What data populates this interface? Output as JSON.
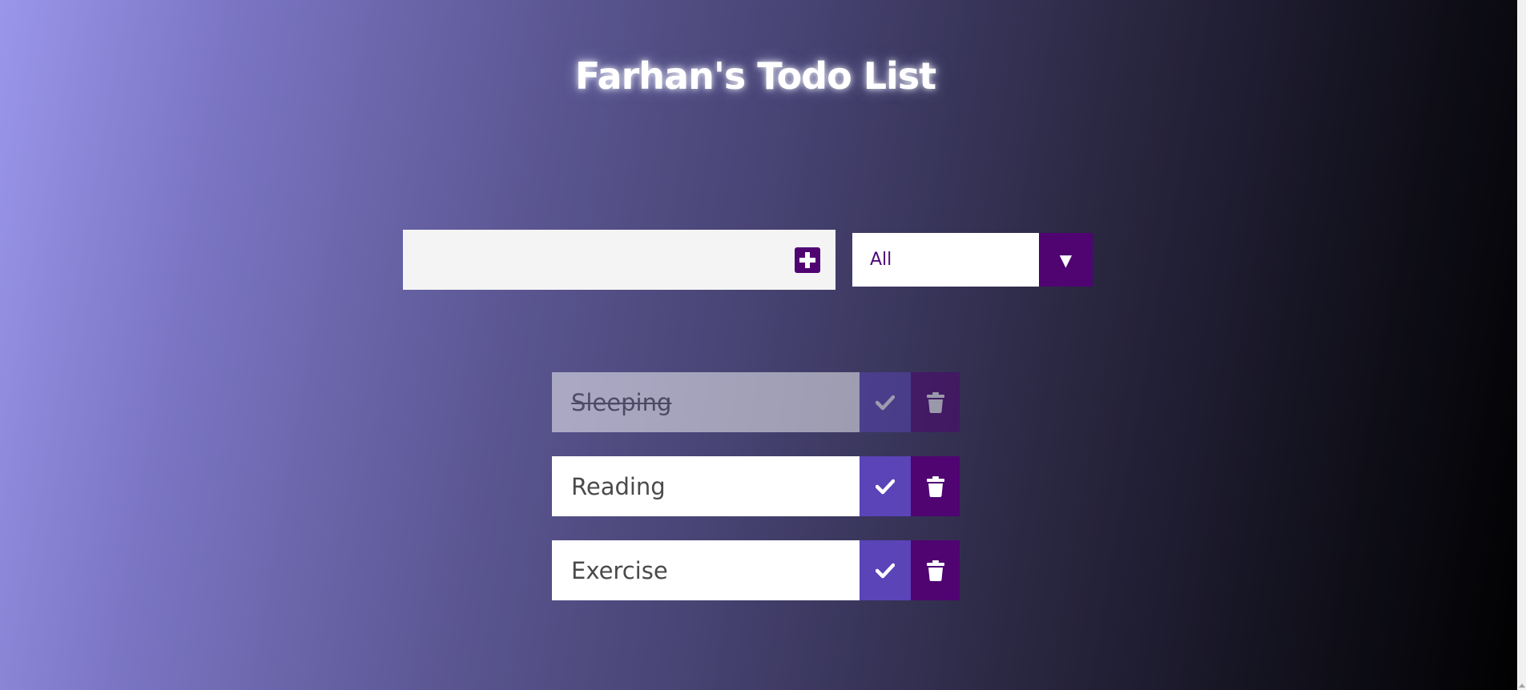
{
  "header": {
    "title": "Farhan's Todo List"
  },
  "add_form": {
    "input_value": "",
    "input_placeholder": "",
    "add_icon": "plus-square-icon"
  },
  "filter": {
    "selected": "All",
    "arrow_glyph": "▼"
  },
  "todos": [
    {
      "text": "Sleeping",
      "completed": true
    },
    {
      "text": "Reading",
      "completed": false
    },
    {
      "text": "Exercise",
      "completed": false
    }
  ],
  "icons": {
    "complete": "check-icon",
    "delete": "trash-icon"
  },
  "colors": {
    "accent_purple": "#4f0472",
    "check_button": "#5a44b8",
    "background_start": "#9a96ea",
    "background_end": "#000000"
  }
}
